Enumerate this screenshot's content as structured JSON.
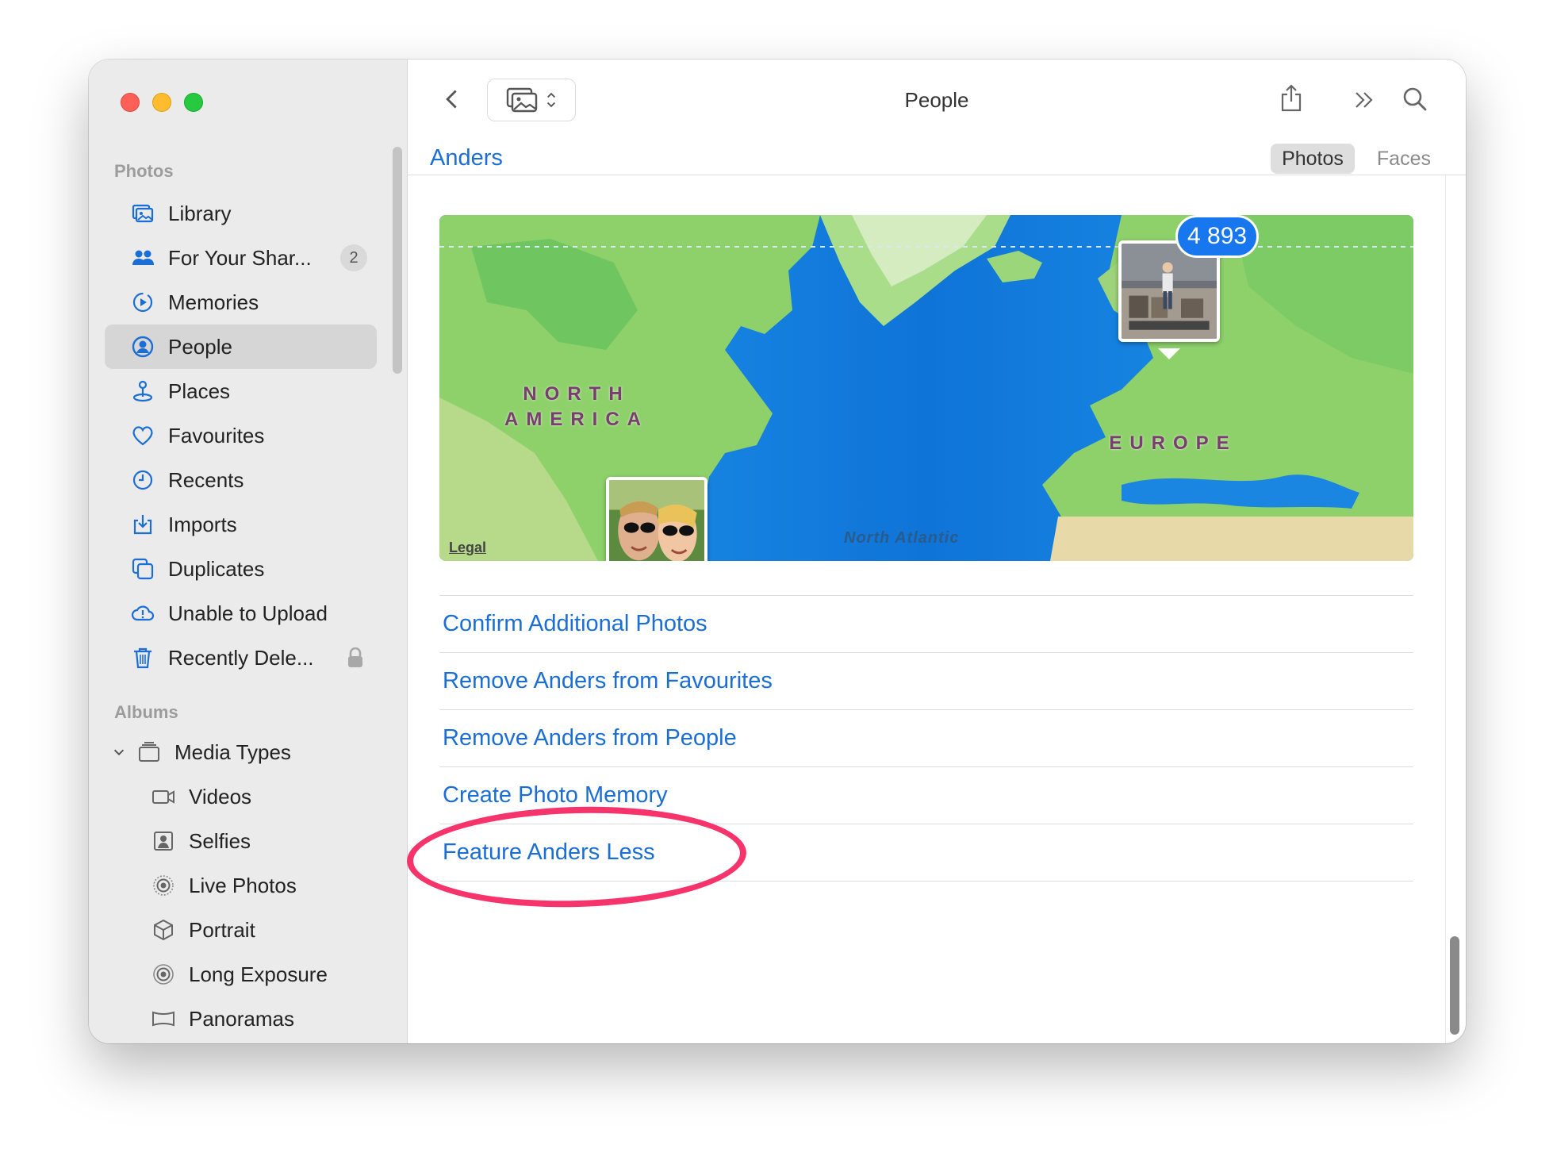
{
  "window": {
    "title": "People"
  },
  "sidebar": {
    "sections": [
      {
        "header": "Photos"
      },
      {
        "header": "Albums"
      }
    ],
    "photos_items": [
      {
        "label": "Library",
        "icon": "library-icon"
      },
      {
        "label": "For Your Shar...",
        "icon": "shared-people-icon",
        "badge": "2"
      },
      {
        "label": "Memories",
        "icon": "memories-icon"
      },
      {
        "label": "People",
        "icon": "people-icon",
        "selected": true
      },
      {
        "label": "Places",
        "icon": "places-pin-icon"
      },
      {
        "label": "Favourites",
        "icon": "heart-icon"
      },
      {
        "label": "Recents",
        "icon": "clock-icon"
      },
      {
        "label": "Imports",
        "icon": "import-icon"
      },
      {
        "label": "Duplicates",
        "icon": "duplicates-icon"
      },
      {
        "label": "Unable to Upload",
        "icon": "cloud-warning-icon"
      },
      {
        "label": "Recently Dele...",
        "icon": "trash-icon",
        "locked": true
      }
    ],
    "albums_items": [
      {
        "label": "Media Types",
        "icon": "stack-icon",
        "expanded": true
      },
      {
        "label": "Videos",
        "icon": "video-icon"
      },
      {
        "label": "Selfies",
        "icon": "selfie-icon"
      },
      {
        "label": "Live Photos",
        "icon": "live-photo-icon"
      },
      {
        "label": "Portrait",
        "icon": "cube-icon"
      },
      {
        "label": "Long Exposure",
        "icon": "long-exposure-icon"
      },
      {
        "label": "Panoramas",
        "icon": "panorama-icon"
      }
    ]
  },
  "header": {
    "person_name": "Anders",
    "segments": [
      {
        "label": "Photos",
        "active": true
      },
      {
        "label": "Faces",
        "active": false
      }
    ]
  },
  "map": {
    "labels": {
      "north_america": "NORTH AMERICA",
      "europe": "EUROPE",
      "ocean": "North Atlantic"
    },
    "legal": "Legal",
    "cluster_count": "4 893"
  },
  "actions": [
    "Confirm Additional Photos",
    "Remove Anders from Favourites",
    "Remove Anders from People",
    "Create Photo Memory",
    "Feature Anders Less"
  ],
  "colors": {
    "accent": "#1a6ed6",
    "highlight": "#f7336b",
    "badge": "#1877ee"
  }
}
